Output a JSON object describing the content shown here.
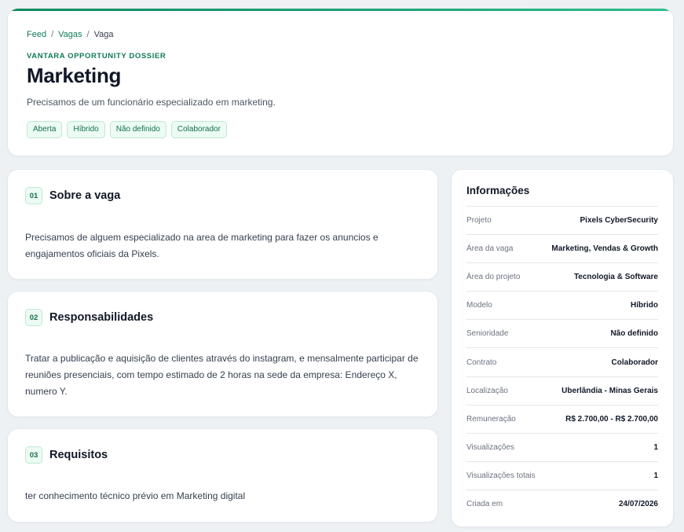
{
  "breadcrumb": {
    "items": [
      "Feed",
      "Vagas",
      "Vaga"
    ],
    "separator": "/"
  },
  "header": {
    "eyebrow": "VANTARA OPPORTUNITY DOSSIER",
    "title": "Marketing",
    "subtitle": "Precisamos de um funcionário especializado em marketing.",
    "tags": [
      "Aberta",
      "Híbrido",
      "Não definido",
      "Colaborador"
    ]
  },
  "sections": [
    {
      "number": "01",
      "title": "Sobre a vaga",
      "body": "Precisamos de alguem especializado na area de marketing para fazer os anuncios e engajamentos oficiais da Pixels."
    },
    {
      "number": "02",
      "title": "Responsabilidades",
      "body": "Tratar a publicação e aquisição de clientes através do instagram, e mensalmente participar de reuniões presenciais, com tempo estimado de 2 horas na sede da empresa: Endereço X, numero Y."
    },
    {
      "number": "03",
      "title": "Requisitos",
      "body": "ter conhecimento técnico prévio em Marketing digital"
    }
  ],
  "info": {
    "title": "Informações",
    "rows": [
      {
        "label": "Projeto",
        "value": "Pixels CyberSecurity"
      },
      {
        "label": "Área da vaga",
        "value": "Marketing, Vendas & Growth"
      },
      {
        "label": "Área do projeto",
        "value": "Tecnologia & Software"
      },
      {
        "label": "Modelo",
        "value": "Híbrido"
      },
      {
        "label": "Senioridade",
        "value": "Não definido"
      },
      {
        "label": "Contrato",
        "value": "Colaborador"
      },
      {
        "label": "Localização",
        "value": "Uberlândia - Minas Gerais"
      },
      {
        "label": "Remuneração",
        "value": "R$ 2.700,00 - R$ 2.700,00"
      },
      {
        "label": "Visualizações",
        "value": "1"
      },
      {
        "label": "Visualizações totais",
        "value": "1"
      },
      {
        "label": "Criada em",
        "value": "24/07/2026"
      }
    ]
  },
  "colors": {
    "accent": "#0f7a55",
    "accent_light": "#ecfbf3",
    "page_bg": "#eef1f4"
  }
}
